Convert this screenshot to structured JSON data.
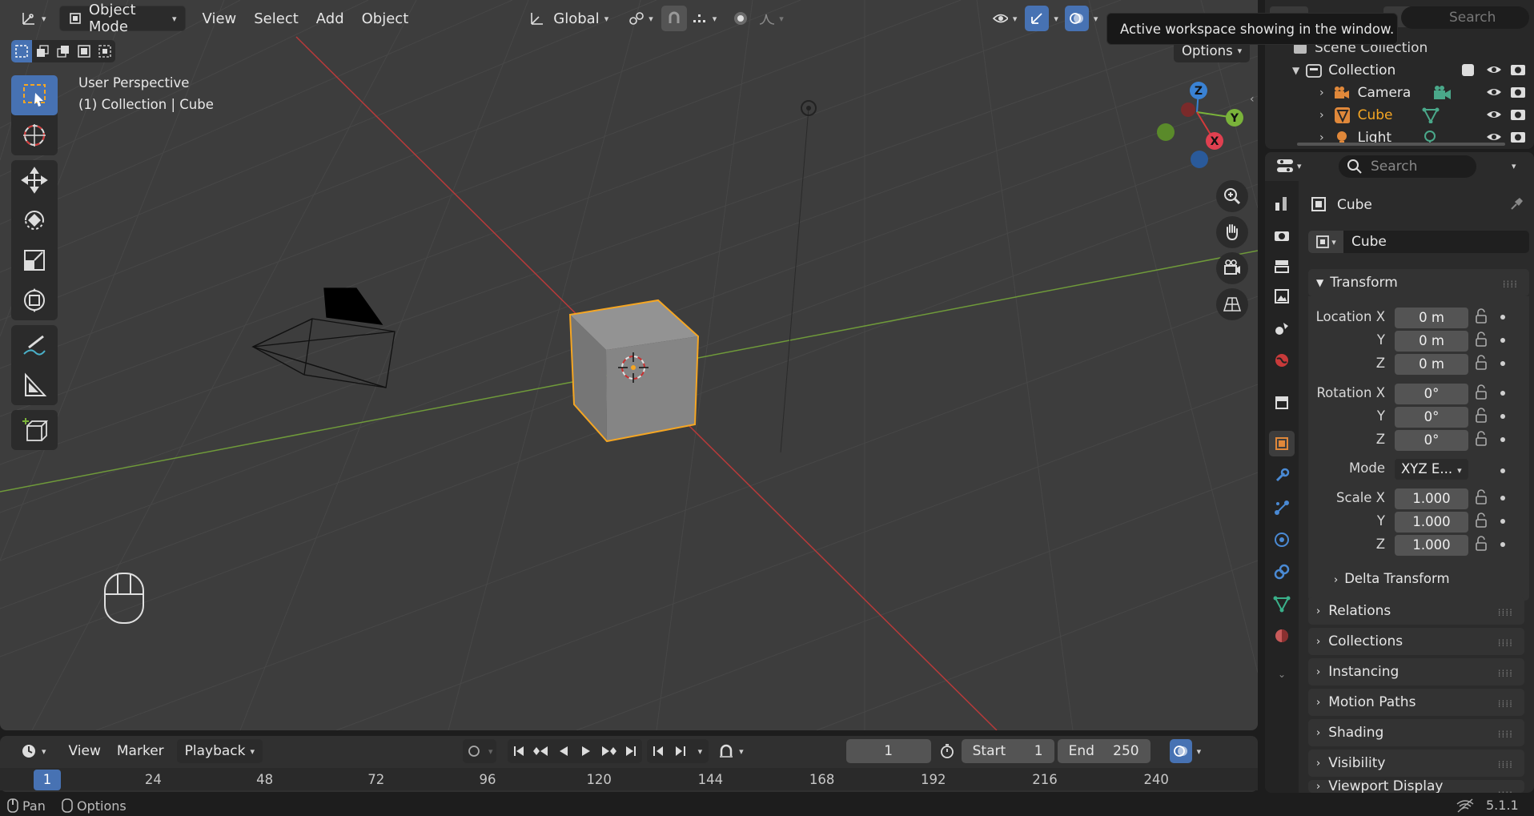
{
  "viewport_header": {
    "editor_icon": "3d-viewport-icon",
    "mode_label": "Object Mode",
    "menus": [
      "View",
      "Select",
      "Add",
      "Object"
    ],
    "transform_orientation": "Global",
    "search_placeholder": "Search"
  },
  "tooltip": "Active workspace showing in the window.",
  "options_label": "Options",
  "viewport_overlay": {
    "perspective_label": "User Perspective",
    "context_label": "(1) Collection | Cube"
  },
  "gizmo_axes": {
    "z": "Z",
    "y": "Y",
    "x": "X"
  },
  "toolbar": [
    "select-box",
    "cursor",
    "move",
    "rotate",
    "scale",
    "transform",
    "annotate",
    "measure",
    "add-cube"
  ],
  "outliner": {
    "scene_collection": "Scene Collection",
    "collection": "Collection",
    "items": [
      {
        "label": "Camera",
        "active": false
      },
      {
        "label": "Cube",
        "active": true
      },
      {
        "label": "Light",
        "active": false
      }
    ]
  },
  "properties": {
    "search_placeholder": "Search",
    "object_name": "Cube",
    "object_name_field": "Cube",
    "transform_panel": "Transform",
    "location": {
      "label_x": "Location X",
      "label_y": "Y",
      "label_z": "Z",
      "x": "0 m",
      "y": "0 m",
      "z": "0 m"
    },
    "rotation": {
      "label_x": "Rotation X",
      "label_y": "Y",
      "label_z": "Z",
      "x": "0°",
      "y": "0°",
      "z": "0°"
    },
    "mode": {
      "label": "Mode",
      "value": "XYZ E..."
    },
    "scale": {
      "label_x": "Scale X",
      "label_y": "Y",
      "label_z": "Z",
      "x": "1.000",
      "y": "1.000",
      "z": "1.000"
    },
    "delta_transform": "Delta Transform",
    "panels": [
      "Relations",
      "Collections",
      "Instancing",
      "Motion Paths",
      "Shading",
      "Visibility",
      "Viewport Display"
    ]
  },
  "timeline": {
    "menus": {
      "view": "View",
      "marker": "Marker",
      "playback": "Playback"
    },
    "current_frame": "1",
    "start_label": "Start",
    "start_value": "1",
    "end_label": "End",
    "end_value": "250",
    "ruler_current": "1",
    "ticks": [
      "24",
      "48",
      "72",
      "96",
      "120",
      "144",
      "168",
      "192",
      "216",
      "240"
    ]
  },
  "statusbar": {
    "pan_label": "Pan",
    "options_label": "Options",
    "version": "5.1.1"
  },
  "colors": {
    "accent": "#4772b3",
    "selected_outline": "#f5a623",
    "x_axis": "#d43a3a",
    "y_axis": "#7ab33a",
    "z_axis": "#3a82d4"
  }
}
